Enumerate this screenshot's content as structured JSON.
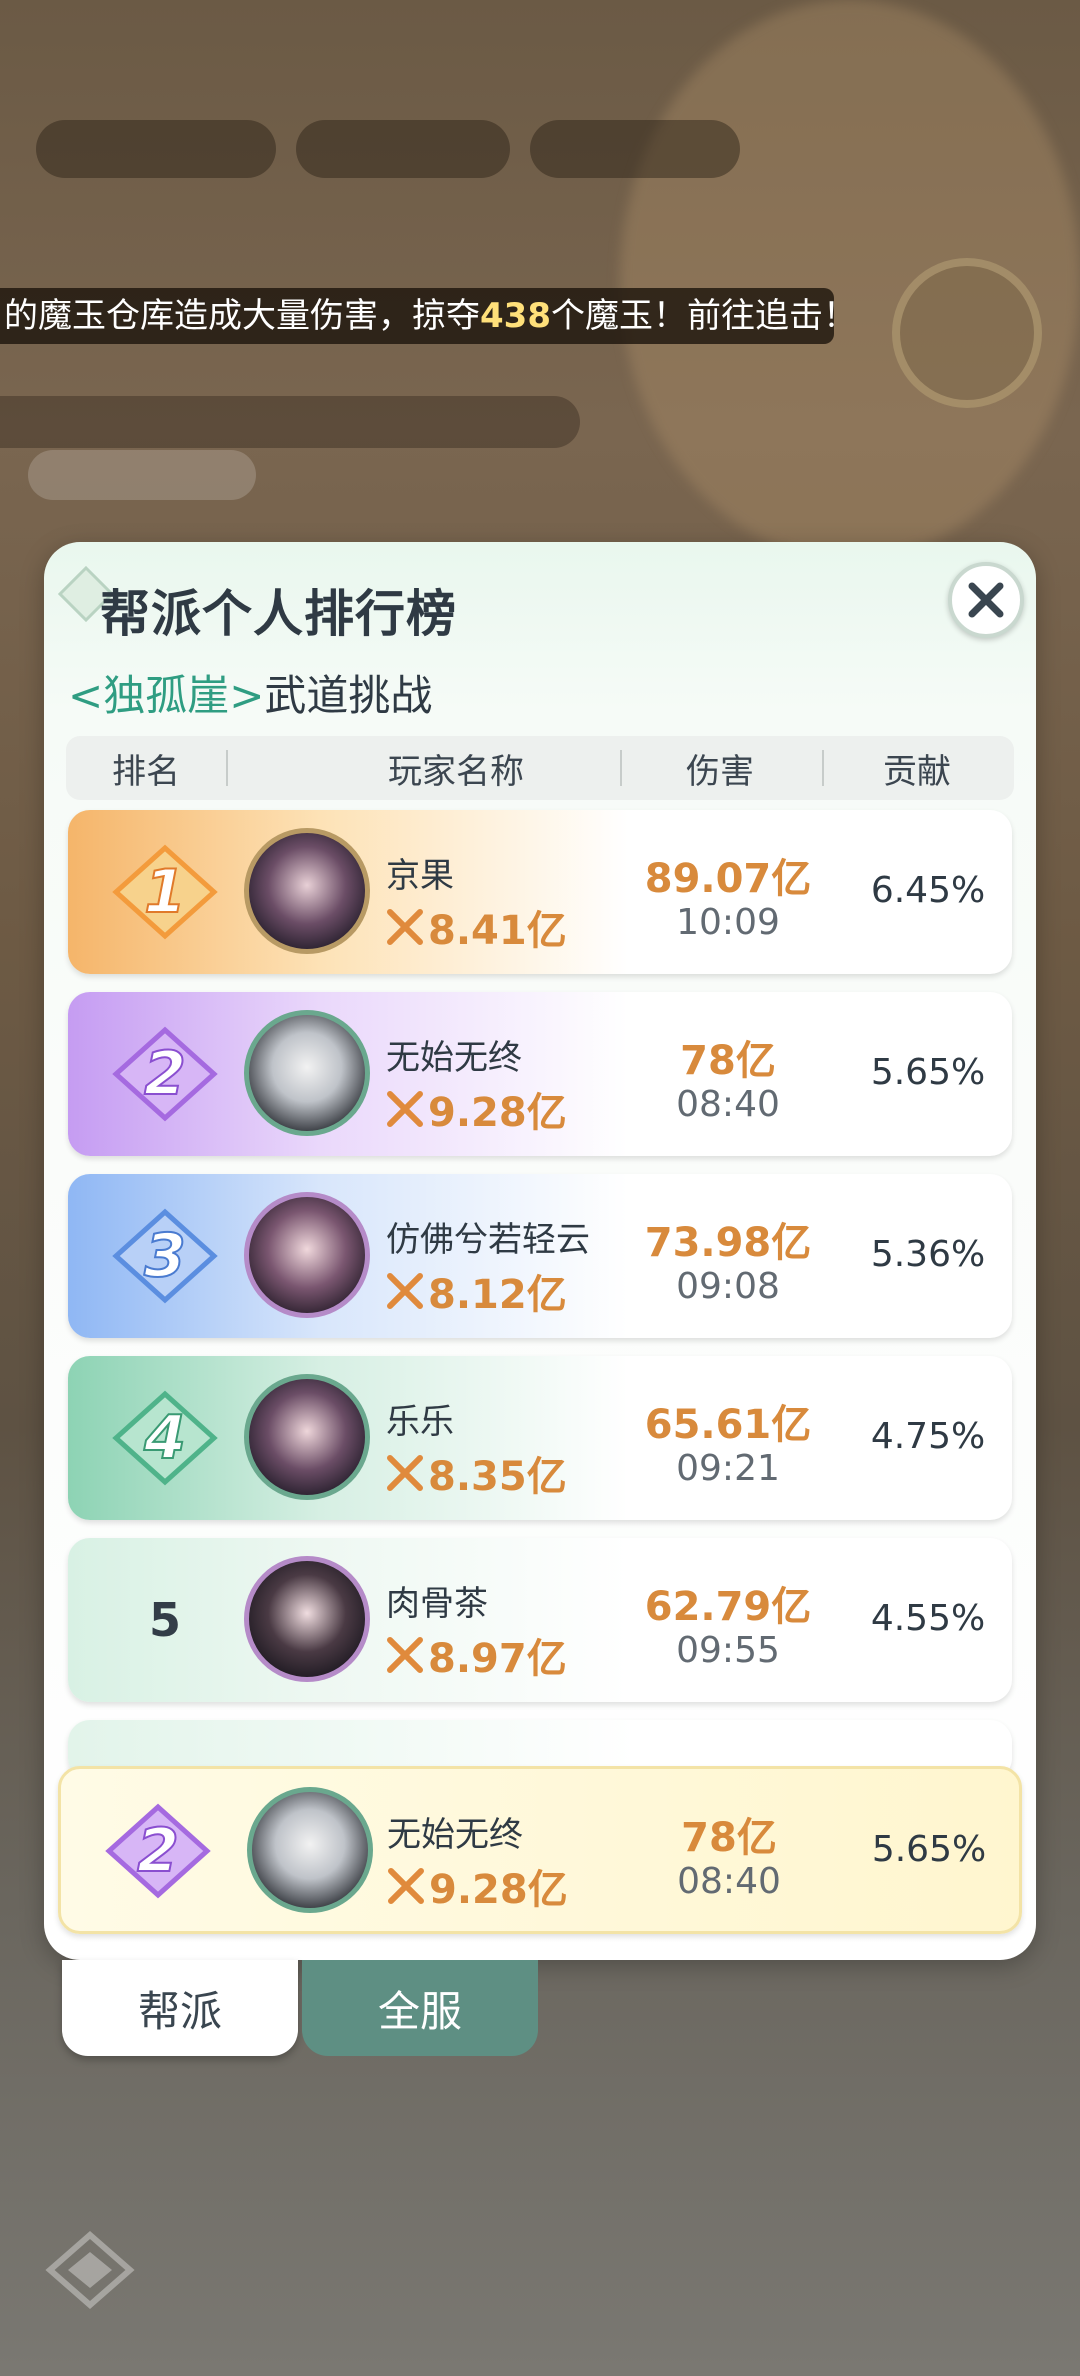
{
  "background": {
    "banner_parts": [
      "的魔玉仓库造成大量伤害，掠夺",
      "438",
      "个魔玉！前往追击！"
    ]
  },
  "panel": {
    "title": "帮派个人排行榜",
    "subtitle_tag": "<独孤崖>",
    "subtitle_text": "武道挑战",
    "close_icon": "close-icon"
  },
  "table": {
    "columns": [
      "排名",
      "玩家名称",
      "伤害",
      "贡献"
    ],
    "rows": [
      {
        "rank": "1",
        "name": "京果",
        "power": "8.41亿",
        "damage": "89.07亿",
        "time": "10:09",
        "contribution": "6.45%"
      },
      {
        "rank": "2",
        "name": "无始无终",
        "power": "9.28亿",
        "damage": "78亿",
        "time": "08:40",
        "contribution": "5.65%"
      },
      {
        "rank": "3",
        "name": "仿佛兮若轻云",
        "power": "8.12亿",
        "damage": "73.98亿",
        "time": "09:08",
        "contribution": "5.36%"
      },
      {
        "rank": "4",
        "name": "乐乐",
        "power": "8.35亿",
        "damage": "65.61亿",
        "time": "09:21",
        "contribution": "4.75%"
      },
      {
        "rank": "5",
        "name": "肉骨茶",
        "power": "8.97亿",
        "damage": "62.79亿",
        "time": "09:55",
        "contribution": "4.55%"
      }
    ]
  },
  "my_rank": {
    "rank": "2",
    "name": "无始无终",
    "power": "9.28亿",
    "damage": "78亿",
    "time": "08:40",
    "contribution": "5.65%"
  },
  "tabs": [
    {
      "label": "帮派",
      "active": true
    },
    {
      "label": "全服",
      "active": false
    }
  ],
  "colors": {
    "accent_orange": "#d88a3c",
    "tag_green": "#2f9d82",
    "tab_active_bg": "#ffffff",
    "tab_inactive_bg": "#5e8f83"
  }
}
